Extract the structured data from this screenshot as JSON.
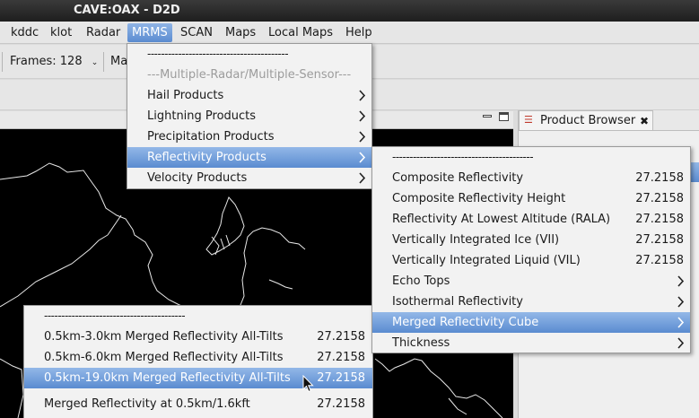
{
  "window": {
    "title": "CAVE:OAX - D2D"
  },
  "menubar": [
    {
      "label": "kddc"
    },
    {
      "label": "klot"
    },
    {
      "label": "Radar"
    },
    {
      "label": "MRMS"
    },
    {
      "label": "SCAN"
    },
    {
      "label": "Maps"
    },
    {
      "label": "Local Maps"
    },
    {
      "label": "Help"
    }
  ],
  "toolbar": {
    "frames_label": "Frames: 128",
    "next_label": "Ma"
  },
  "product_browser": {
    "tab_label": "Product Browser"
  },
  "separator_line": "-----------------------------------------",
  "mrms_menu": {
    "header": "---Multiple-Radar/Multiple-Sensor---",
    "items": [
      {
        "label": "Hail Products"
      },
      {
        "label": "Lightning Products"
      },
      {
        "label": "Precipitation Products"
      },
      {
        "label": "Reflectivity Products"
      },
      {
        "label": "Velocity Products"
      }
    ]
  },
  "reflectivity_menu": {
    "items": [
      {
        "label": "Composite Reflectivity",
        "value": "27.2158"
      },
      {
        "label": "Composite Reflectivity Height",
        "value": "27.2158"
      },
      {
        "label": "Reflectivity At Lowest Altitude (RALA)",
        "value": "27.2158"
      },
      {
        "label": "Vertically Integrated Ice (VII)",
        "value": "27.2158"
      },
      {
        "label": "Vertically Integrated Liquid (VIL)",
        "value": "27.2158"
      },
      {
        "label": "Echo Tops",
        "value": ""
      },
      {
        "label": "Isothermal Reflectivity",
        "value": ""
      },
      {
        "label": "Merged Reflectivity Cube",
        "value": ""
      },
      {
        "label": "Thickness",
        "value": ""
      }
    ]
  },
  "cube_menu": {
    "items": [
      {
        "label": "0.5km-3.0km Merged Reflectivity All-Tilts",
        "value": "27.2158"
      },
      {
        "label": "0.5km-6.0km Merged Reflectivity All-Tilts",
        "value": "27.2158"
      },
      {
        "label": "0.5km-19.0km Merged Reflectivity All-Tilts",
        "value": "27.2158"
      },
      {
        "label": "Merged Reflectivity at 0.5km/1.6kft",
        "value": "27.2158"
      }
    ]
  }
}
